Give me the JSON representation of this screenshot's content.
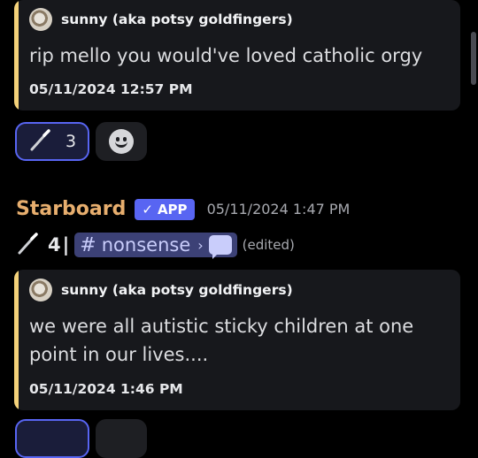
{
  "embeds": [
    {
      "author": "sunny (aka potsy goldfingers)",
      "text": "rip mello you would've loved catholic orgy",
      "timestamp": "05/11/2024 12:57 PM"
    },
    {
      "author": "sunny (aka potsy goldfingers)",
      "text": "we were all autistic sticky children at one point in our lives....",
      "timestamp": "05/11/2024 1:46 PM"
    }
  ],
  "reactions": [
    {
      "icon": "magic-wand-icon",
      "count": "3",
      "active": true
    },
    {
      "icon": "add-reaction-icon",
      "count": "",
      "active": false
    }
  ],
  "bot_message": {
    "name": "Starboard",
    "badge": "APP",
    "badge_check": "✓",
    "timestamp": "05/11/2024 1:47 PM",
    "star_count": "4",
    "separator": "|",
    "channel": "nonsense",
    "channel_hash": "#",
    "channel_chevron": "›",
    "edited": "(edited)"
  },
  "colors": {
    "background": "#000000",
    "embed_bg": "#17181c",
    "embed_bar": "#f4d27a",
    "bot_name": "#e7ae6e",
    "accent": "#5865f2"
  }
}
